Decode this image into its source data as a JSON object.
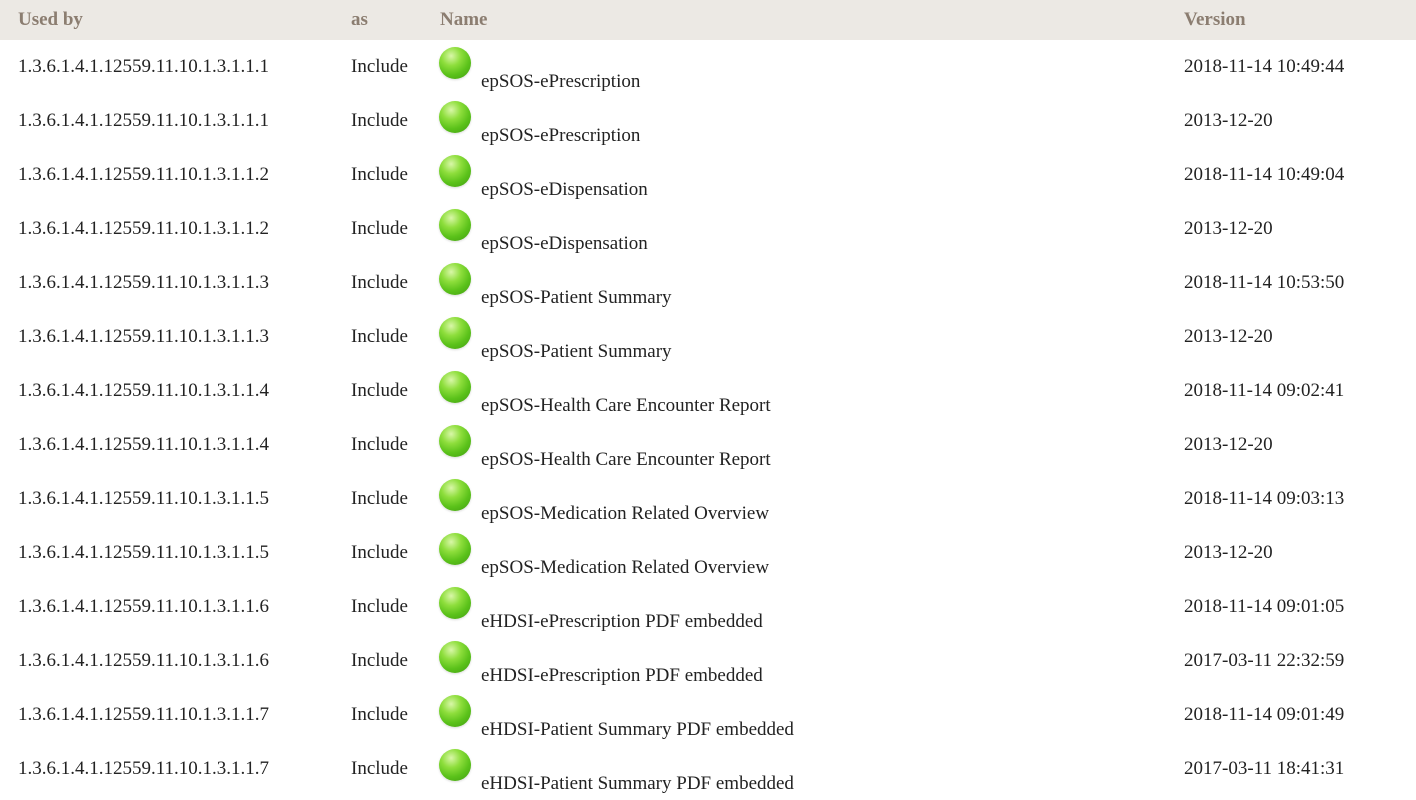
{
  "header": {
    "used_by": "Used by",
    "as": "as",
    "name": "Name",
    "version": "Version"
  },
  "status_color": "#5bc21a",
  "header_bg": "#ece9e4",
  "header_text_color": "#8b7d70",
  "rows": [
    {
      "used_by": "1.3.6.1.4.1.12559.11.10.1.3.1.1.1",
      "as": "Include",
      "icon": "active-status-icon",
      "name": "epSOS-ePrescription",
      "version": "2018-11-14 10:49:44"
    },
    {
      "used_by": "1.3.6.1.4.1.12559.11.10.1.3.1.1.1",
      "as": "Include",
      "icon": "active-status-icon",
      "name": "epSOS-ePrescription",
      "version": "2013-12-20"
    },
    {
      "used_by": "1.3.6.1.4.1.12559.11.10.1.3.1.1.2",
      "as": "Include",
      "icon": "active-status-icon",
      "name": "epSOS-eDispensation",
      "version": "2018-11-14 10:49:04"
    },
    {
      "used_by": "1.3.6.1.4.1.12559.11.10.1.3.1.1.2",
      "as": "Include",
      "icon": "active-status-icon",
      "name": "epSOS-eDispensation",
      "version": "2013-12-20"
    },
    {
      "used_by": "1.3.6.1.4.1.12559.11.10.1.3.1.1.3",
      "as": "Include",
      "icon": "active-status-icon",
      "name": "epSOS-Patient Summary",
      "version": "2018-11-14 10:53:50"
    },
    {
      "used_by": "1.3.6.1.4.1.12559.11.10.1.3.1.1.3",
      "as": "Include",
      "icon": "active-status-icon",
      "name": "epSOS-Patient Summary",
      "version": "2013-12-20"
    },
    {
      "used_by": "1.3.6.1.4.1.12559.11.10.1.3.1.1.4",
      "as": "Include",
      "icon": "active-status-icon",
      "name": "epSOS-Health Care Encounter Report",
      "version": "2018-11-14 09:02:41"
    },
    {
      "used_by": "1.3.6.1.4.1.12559.11.10.1.3.1.1.4",
      "as": "Include",
      "icon": "active-status-icon",
      "name": "epSOS-Health Care Encounter Report",
      "version": "2013-12-20"
    },
    {
      "used_by": "1.3.6.1.4.1.12559.11.10.1.3.1.1.5",
      "as": "Include",
      "icon": "active-status-icon",
      "name": "epSOS-Medication Related Overview",
      "version": "2018-11-14 09:03:13"
    },
    {
      "used_by": "1.3.6.1.4.1.12559.11.10.1.3.1.1.5",
      "as": "Include",
      "icon": "active-status-icon",
      "name": "epSOS-Medication Related Overview",
      "version": "2013-12-20"
    },
    {
      "used_by": "1.3.6.1.4.1.12559.11.10.1.3.1.1.6",
      "as": "Include",
      "icon": "active-status-icon",
      "name": "eHDSI-ePrescription PDF embedded",
      "version": "2018-11-14 09:01:05"
    },
    {
      "used_by": "1.3.6.1.4.1.12559.11.10.1.3.1.1.6",
      "as": "Include",
      "icon": "active-status-icon",
      "name": "eHDSI-ePrescription PDF embedded",
      "version": "2017-03-11 22:32:59"
    },
    {
      "used_by": "1.3.6.1.4.1.12559.11.10.1.3.1.1.7",
      "as": "Include",
      "icon": "active-status-icon",
      "name": "eHDSI-Patient Summary PDF embedded",
      "version": "2018-11-14 09:01:49"
    },
    {
      "used_by": "1.3.6.1.4.1.12559.11.10.1.3.1.1.7",
      "as": "Include",
      "icon": "active-status-icon",
      "name": "eHDSI-Patient Summary PDF embedded",
      "version": "2017-03-11 18:41:31"
    }
  ]
}
